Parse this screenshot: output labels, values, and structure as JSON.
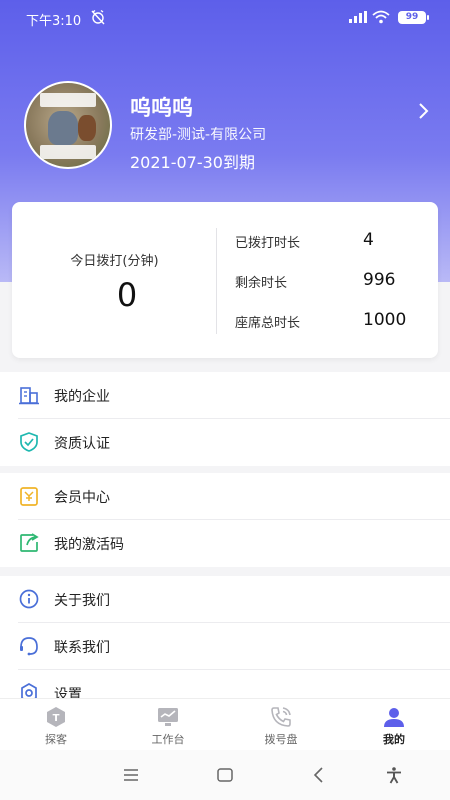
{
  "status_bar": {
    "time": "下午3:10",
    "battery": "99"
  },
  "profile": {
    "name": "呜呜呜",
    "department": "研发部-测试-有限公司",
    "expire": "2021-07-30到期"
  },
  "stats": {
    "today_label": "今日拨打(分钟)",
    "today_value": "0",
    "rows": [
      {
        "label": "已拨打时长",
        "value": "4"
      },
      {
        "label": "剩余时长",
        "value": "996"
      },
      {
        "label": "座席总时长",
        "value": "1000"
      }
    ]
  },
  "menu": {
    "group1": [
      {
        "label": "我的企业",
        "icon": "building-icon"
      },
      {
        "label": "资质认证",
        "icon": "shield-check-icon"
      }
    ],
    "group2": [
      {
        "label": "会员中心",
        "icon": "member-card-icon"
      },
      {
        "label": "我的激活码",
        "icon": "share-code-icon"
      }
    ],
    "group3": [
      {
        "label": "关于我们",
        "icon": "info-icon"
      },
      {
        "label": "联系我们",
        "icon": "headset-icon"
      },
      {
        "label": "设置",
        "icon": "settings-icon"
      }
    ]
  },
  "tabs": [
    {
      "label": "探客",
      "icon": "explore-icon",
      "active": false
    },
    {
      "label": "工作台",
      "icon": "workbench-icon",
      "active": false
    },
    {
      "label": "拨号盘",
      "icon": "phone-icon",
      "active": false
    },
    {
      "label": "我的",
      "icon": "profile-icon",
      "active": true
    }
  ],
  "colors": {
    "accent": "#5d5fea",
    "icon_blue": "#4a6fd8",
    "icon_teal": "#1fb8b0",
    "icon_gold": "#f0b429",
    "icon_green": "#2eb872"
  }
}
